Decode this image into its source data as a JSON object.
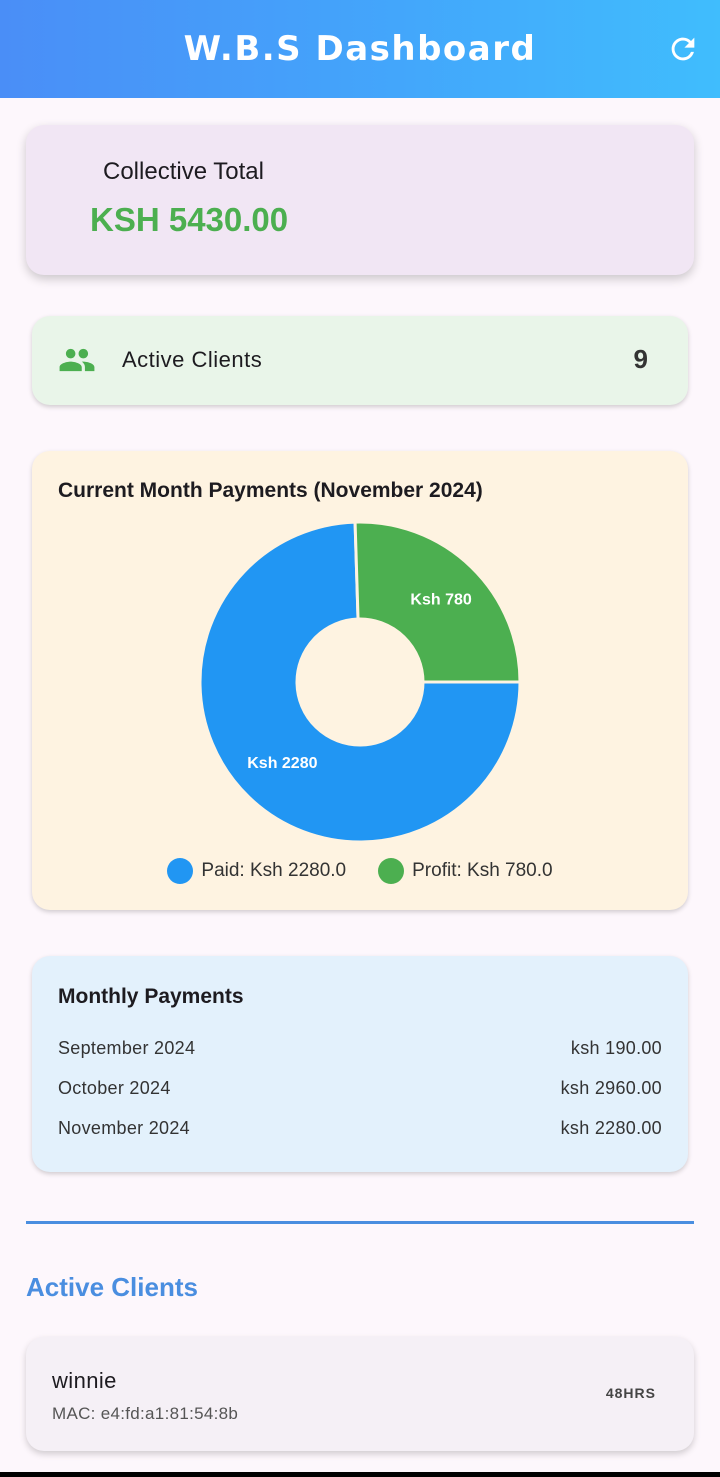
{
  "appbar": {
    "title": "W.B.S Dashboard",
    "refresh_icon": "refresh-icon"
  },
  "collective_total": {
    "label": "Collective Total",
    "value": "KSH 5430.00"
  },
  "active_clients_summary": {
    "icon": "people-icon",
    "label": "Active Clients",
    "count": "9"
  },
  "current_month": {
    "title": "Current Month Payments (November 2024)",
    "legend": [
      {
        "label": "Paid: Ksh 2280.0",
        "color": "#2196f3"
      },
      {
        "label": "Profit: Ksh 780.0",
        "color": "#4caf50"
      }
    ]
  },
  "chart_data": {
    "type": "pie",
    "categories": [
      "Paid",
      "Profit"
    ],
    "values": [
      2280,
      780
    ],
    "slice_labels": [
      "Ksh 2280",
      "Ksh 780"
    ],
    "colors": [
      "#2196f3",
      "#4caf50"
    ],
    "donut": true
  },
  "monthly_payments": {
    "title": "Monthly Payments",
    "rows": [
      {
        "month": "September 2024",
        "amount": "ksh 190.00"
      },
      {
        "month": "October 2024",
        "amount": "ksh 2960.00"
      },
      {
        "month": "November 2024",
        "amount": "ksh 2280.00"
      }
    ]
  },
  "active_clients_section": {
    "title": "Active Clients",
    "clients": [
      {
        "name": "winnie",
        "mac": "MAC: e4:fd:a1:81:54:8b",
        "duration": "48HRS"
      }
    ]
  }
}
